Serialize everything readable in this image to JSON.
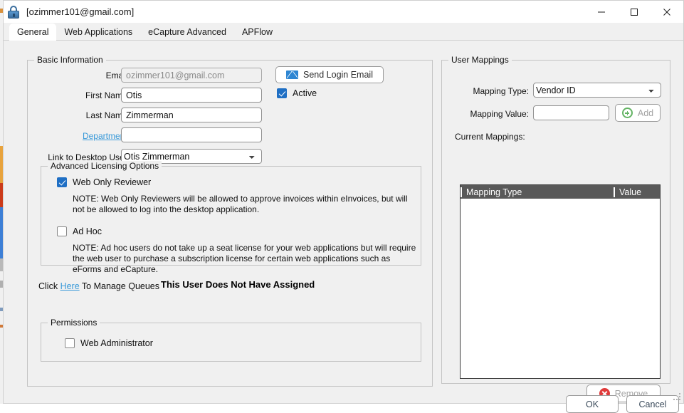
{
  "window": {
    "title": "[ozimmer101@gmail.com]",
    "lock_icon": "lock-icon",
    "minimize": "minimize-icon",
    "maximize": "maximize-icon",
    "close": "close-icon"
  },
  "tabs": [
    {
      "label": "General",
      "active": true
    },
    {
      "label": "Web Applications",
      "active": false
    },
    {
      "label": "eCapture Advanced",
      "active": false
    },
    {
      "label": "APFlow",
      "active": false
    }
  ],
  "basic_information": {
    "title": "Basic Information",
    "email_label": "Email:",
    "email_value": "ozimmer101@gmail.com",
    "first_name_label": "First Name:",
    "first_name_value": "Otis",
    "last_name_label": "Last Name:",
    "last_name_value": "Zimmerman",
    "department_label": "Department:",
    "department_value": "",
    "link_desktop_label": "Link to Desktop User:",
    "link_desktop_value": "Otis  Zimmerman",
    "send_login_email": "Send Login Email",
    "active_label": "Active"
  },
  "advanced_licensing": {
    "title": "Advanced Licensing Options",
    "web_only_reviewer_label": "Web Only Reviewer",
    "web_only_reviewer_note": "NOTE: Web Only Reviewers will be allowed to approve invoices within eInvoices, but will not be allowed to log into the desktop application.",
    "ad_hoc_label": "Ad Hoc",
    "ad_hoc_note": "NOTE: Ad hoc users do not take up a seat license for your web applications but will require the web user to purchase a subscription license for certain web applications such as eForms and eCapture."
  },
  "queues": {
    "prefix": "Click ",
    "link": "Here",
    "suffix": " To Manage Queues",
    "status": "This User Does Not Have Assigned\nQueues"
  },
  "permissions": {
    "title": "Permissions",
    "web_administrator_label": "Web Administrator"
  },
  "user_mappings": {
    "title": "User Mappings",
    "mapping_type_label": "Mapping Type:",
    "mapping_type_value": "Vendor ID",
    "mapping_value_label": "Mapping Value:",
    "mapping_value": "",
    "add_label": "Add",
    "current_mappings_label": "Current Mappings:",
    "columns": [
      "Mapping Type",
      "Value"
    ],
    "rows": [],
    "remove_label": "Remove"
  },
  "footer": {
    "ok_label": "OK",
    "cancel_label": "Cancel"
  },
  "colors": {
    "accent_blue": "#1f6fc4",
    "link_blue": "#3a9ad9",
    "add_green": "#63b363",
    "remove_red": "#e03b3b",
    "header_gray": "#595959",
    "window_bg": "#f0f0f0"
  }
}
